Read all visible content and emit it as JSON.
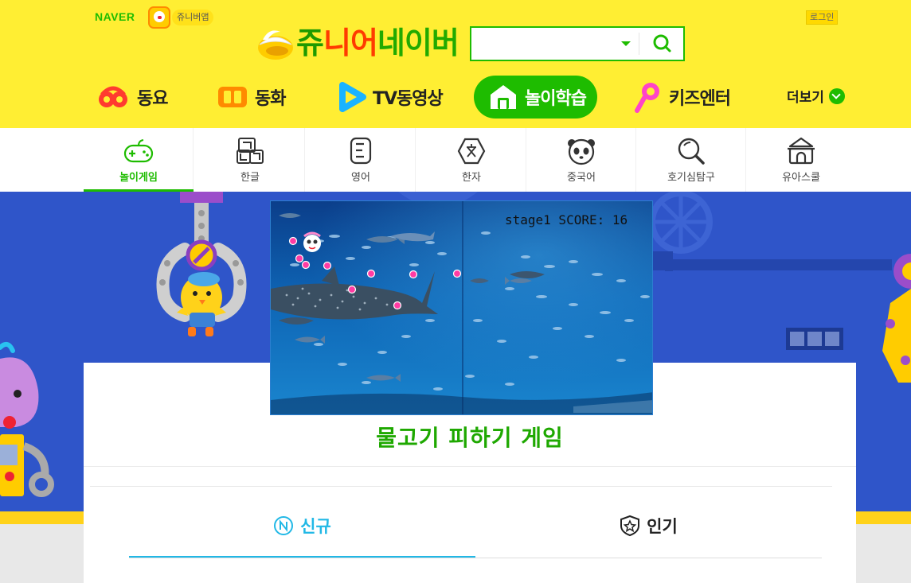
{
  "header": {
    "naver_logo": "NAVER",
    "app_label": "쥬니버앱",
    "login_label": "로그인",
    "brand_title": [
      "쥬",
      "니",
      "어",
      "네이버"
    ],
    "search": {
      "value": "",
      "placeholder": ""
    },
    "nav": [
      {
        "label": "동요",
        "icon": "song-icon",
        "color": "#ff3b2f"
      },
      {
        "label": "동화",
        "icon": "book-icon",
        "color": "#ff8a00"
      },
      {
        "label": "TV동영상",
        "icon": "play-icon",
        "color": "#1ab3ff"
      },
      {
        "label": "놀이학습",
        "icon": "house-icon",
        "color": "#1ebc00",
        "active": true
      },
      {
        "label": "키즈엔터",
        "icon": "microphone-icon",
        "color": "#ff44c8"
      }
    ],
    "more_label": "더보기"
  },
  "subnav": [
    {
      "label": "놀이게임",
      "icon": "gamepad-icon",
      "active": true
    },
    {
      "label": "한글",
      "icon": "korean-letters-icon"
    },
    {
      "label": "영어",
      "icon": "english-letter-icon"
    },
    {
      "label": "한자",
      "icon": "hanja-icon"
    },
    {
      "label": "중국어",
      "icon": "panda-icon"
    },
    {
      "label": "호기심탐구",
      "icon": "magnifier-icon"
    },
    {
      "label": "유아스쿨",
      "icon": "school-icon"
    }
  ],
  "game": {
    "hud": "stage1 SCORE: 16",
    "title": "물고기 피하기 게임"
  },
  "tabs": [
    {
      "label": "신규",
      "icon": "new-badge-icon",
      "active": true
    },
    {
      "label": "인기",
      "icon": "star-badge-icon"
    }
  ],
  "colors": {
    "brand_green": "#1ebc00",
    "header_yellow": "#ffee33",
    "stage_blue": "#2f55c9",
    "tab_cyan": "#21b8e6"
  }
}
